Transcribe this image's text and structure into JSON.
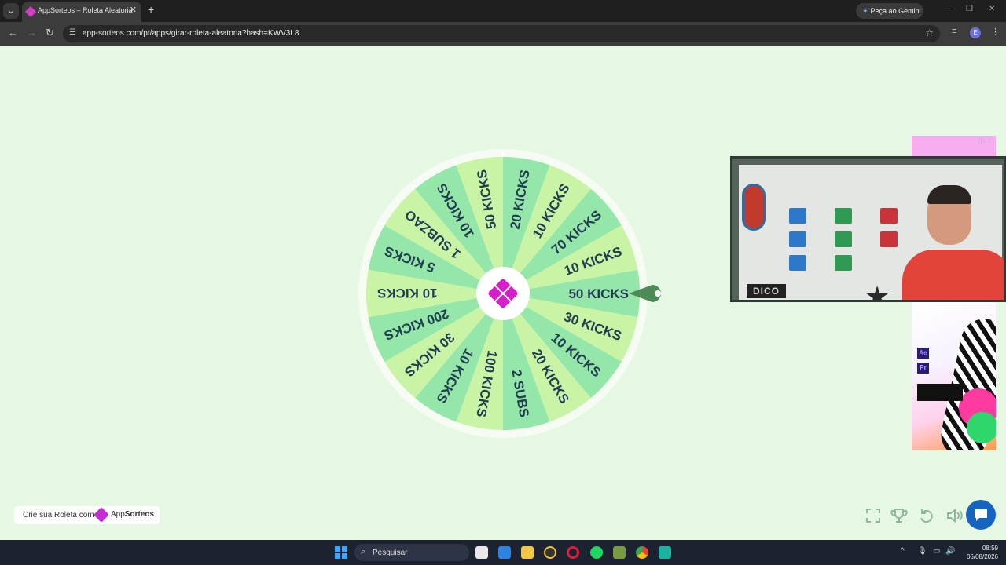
{
  "browser": {
    "tab_title": "AppSorteos – Roleta Aleatoria",
    "gemini_label": "Peça ao Gemini",
    "url": "app-sorteos.com/pt/apps/girar-roleta-aleatoria?hash=KWV3L8",
    "profile_initial": "E"
  },
  "wheel": {
    "segments": [
      "50 KICKS",
      "30 KICKS",
      "10 KICKS",
      "20 KICKS",
      "2 SUBS",
      "100 KICKS",
      "10 KICKS",
      "30 KICKS",
      "200 KICKS",
      "10 KICKS",
      "5 KICKS",
      "1 SUBZAO",
      "10 KICKS",
      "50 KICKS",
      "20 KICKS",
      "10 KICKS",
      "70 KICKS",
      "10 KICKS"
    ],
    "colors": [
      "#94e7a8",
      "#c9f4a6"
    ],
    "text_color": "#213d52",
    "center_logo_color": "#d61fcb"
  },
  "webcam": {
    "logo_text": "DICO"
  },
  "ad": {
    "ae": "Ae",
    "pr": "Pr"
  },
  "footer": {
    "create_label": "Crie sua Roleta com",
    "brand_prefix": "App",
    "brand_bold": "Sorteos"
  },
  "controls": [
    "fullscreen-icon",
    "trophy-icon",
    "undo-icon",
    "volume-icon",
    "chat-icon"
  ],
  "taskbar": {
    "search_placeholder": "Pesquisar",
    "time": "08:59",
    "date": "06/08/2026"
  }
}
